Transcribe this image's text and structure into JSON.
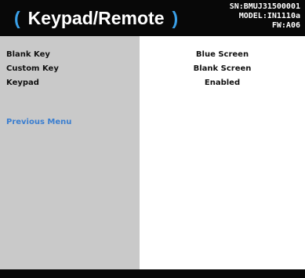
{
  "header": {
    "title": "Keypad/Remote",
    "paren_open": "(",
    "paren_close": ")",
    "serial": "SN:BMUJ31500001",
    "model": "MODEL:IN1110a",
    "firmware": "FW:A06"
  },
  "menu": {
    "items": [
      {
        "label": "Blank Key",
        "value": "Blue Screen"
      },
      {
        "label": "Custom Key",
        "value": "Blank Screen"
      },
      {
        "label": "Keypad",
        "value": "Enabled"
      }
    ],
    "previous_menu": "Previous Menu"
  },
  "colors": {
    "header_bg": "#080808",
    "accent": "#3aa0e8",
    "link": "#3a7ed0",
    "left_panel_bg": "#c9c9c9",
    "right_panel_bg": "#ffffff"
  }
}
